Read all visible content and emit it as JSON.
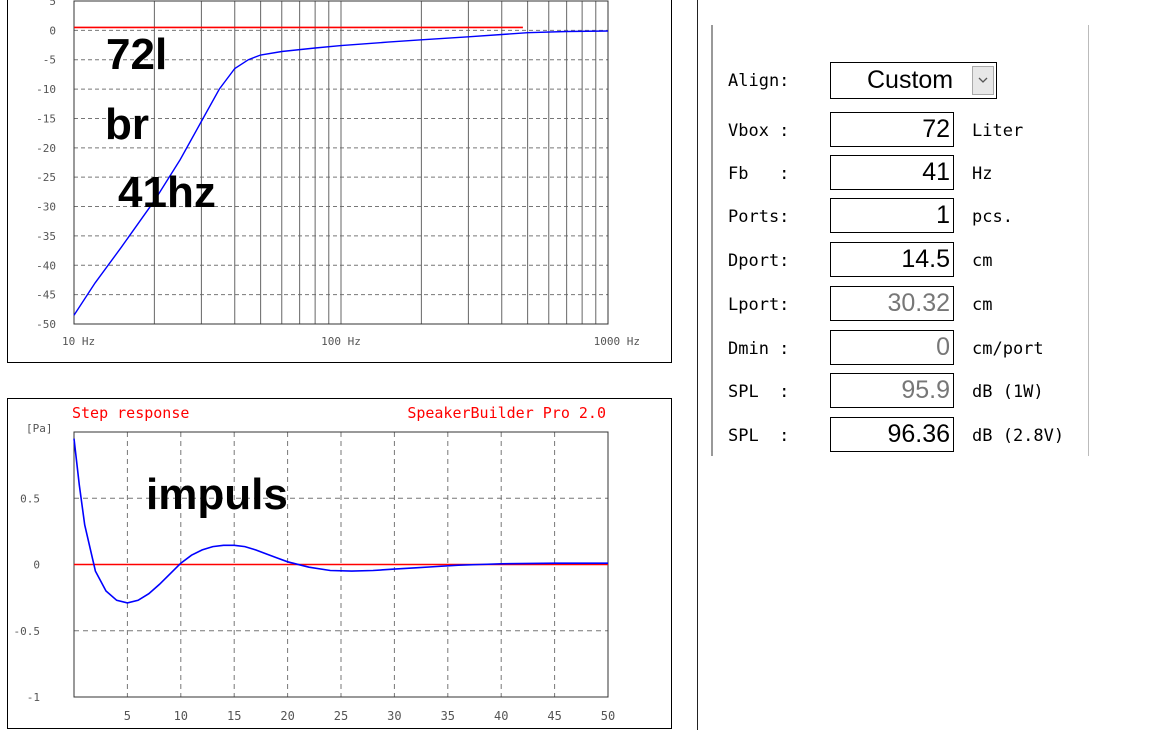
{
  "freq_chart": {
    "y_ticks": [
      "5",
      "0",
      "-5",
      "-10",
      "-15",
      "-20",
      "-25",
      "-30",
      "-35",
      "-40",
      "-45",
      "-50"
    ],
    "x_ticks": [
      "10 Hz",
      "100 Hz",
      "1000 Hz"
    ],
    "annotations": [
      "72l",
      "br",
      "41hz"
    ],
    "colors": {
      "curve": "#0000ff",
      "reference": "#ff0000",
      "grid": "#666666"
    }
  },
  "step_chart": {
    "title": "Step response",
    "brand": "SpeakerBuilder Pro 2.0",
    "y_unit": "[Pa]",
    "y_ticks": [
      "0.5",
      "0",
      "-0.5",
      "-1"
    ],
    "x_ticks": [
      "5",
      "10",
      "15",
      "20",
      "25",
      "30",
      "35",
      "40",
      "45",
      "50"
    ],
    "annotation": "impuls"
  },
  "chart_data": [
    {
      "type": "line",
      "xscale": "log",
      "xlim": [
        10,
        1100
      ],
      "ylim": [
        -50,
        5
      ],
      "grid": true,
      "series": [
        {
          "x": [
            10,
            12,
            15,
            20,
            25,
            30,
            35,
            40,
            45,
            50,
            60,
            80,
            100,
            150,
            200,
            300,
            400,
            500,
            700,
            1000
          ],
          "y": [
            -48.5,
            -43,
            -37,
            -29,
            -22,
            -15.5,
            -10,
            -6.5,
            -5,
            -4.2,
            -3.6,
            -3,
            -2.6,
            -2,
            -1.6,
            -1.1,
            -0.7,
            -0.4,
            -0.2,
            -0.1
          ]
        },
        {
          "x": [
            10,
            1000
          ],
          "y": [
            -0.3,
            -0.3
          ]
        }
      ],
      "annotations": [
        "72l",
        "br",
        "41hz"
      ]
    },
    {
      "type": "line",
      "title": "Step response",
      "ylabel": "[Pa]",
      "xlim": [
        0,
        50
      ],
      "ylim": [
        -1,
        1
      ],
      "grid": true,
      "series": [
        {
          "x": [
            0,
            0.5,
            1,
            2,
            3,
            4,
            5,
            6,
            7,
            8,
            9,
            10,
            11,
            12,
            13,
            14,
            15,
            16,
            17,
            18,
            19,
            20,
            22,
            24,
            26,
            28,
            30,
            32,
            34,
            36,
            38,
            40,
            45,
            50
          ],
          "y": [
            0.95,
            0.6,
            0.3,
            -0.05,
            -0.2,
            -0.27,
            -0.29,
            -0.27,
            -0.22,
            -0.15,
            -0.07,
            0.01,
            0.07,
            0.11,
            0.135,
            0.145,
            0.145,
            0.135,
            0.11,
            0.08,
            0.05,
            0.02,
            -0.02,
            -0.045,
            -0.05,
            -0.045,
            -0.035,
            -0.025,
            -0.015,
            -0.005,
            0.0,
            0.005,
            0.01,
            0.01
          ]
        },
        {
          "x": [
            0,
            50
          ],
          "y": [
            0,
            0
          ]
        }
      ],
      "annotations": [
        "impuls"
      ]
    }
  ],
  "params": {
    "align": {
      "label": "Align:",
      "value": "Custom"
    },
    "rows": [
      {
        "label": "Vbox :",
        "value": "72",
        "unit": "Liter",
        "readonly": false
      },
      {
        "label": "Fb   :",
        "value": "41",
        "unit": "Hz",
        "readonly": false
      },
      {
        "label": "Ports:",
        "value": "1",
        "unit": "pcs.",
        "readonly": false
      },
      {
        "label": "Dport:",
        "value": "14.5",
        "unit": "cm",
        "readonly": false
      },
      {
        "label": "Lport:",
        "value": "30.32",
        "unit": "cm",
        "readonly": true
      },
      {
        "label": "Dmin :",
        "value": "0",
        "unit": "cm/port",
        "readonly": true
      },
      {
        "label": "SPL  :",
        "value": "95.9",
        "unit": "dB (1W)",
        "readonly": true
      },
      {
        "label": "SPL  :",
        "value": "96.36",
        "unit": "dB (2.8V)",
        "readonly": false
      }
    ]
  }
}
